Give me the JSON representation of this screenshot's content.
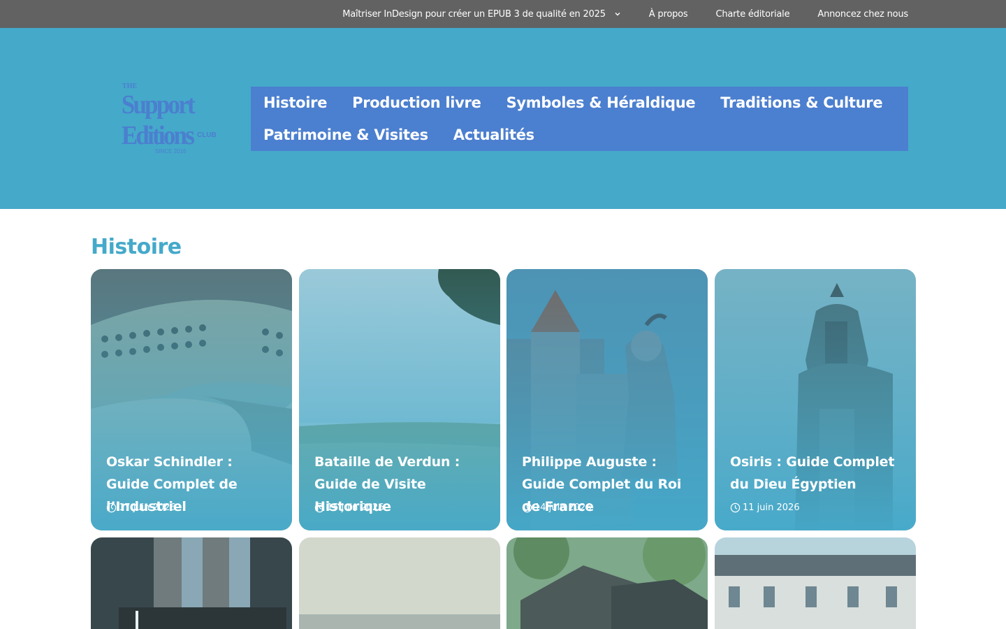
{
  "topbar": {
    "links": [
      {
        "label": "Maîtriser InDesign pour créer un EPUB 3 de qualité en 2025",
        "has_dropdown": true
      },
      {
        "label": "À propos"
      },
      {
        "label": "Charte éditoriale"
      },
      {
        "label": "Annoncez chez nous"
      }
    ]
  },
  "logo": {
    "the": "THE",
    "line1": "Support",
    "line2": "Editions",
    "club": "CLUB",
    "since": "SINCE 2016"
  },
  "nav": {
    "row1": [
      "Histoire",
      "Production livre",
      "Symboles & Héraldique",
      "Traditions & Culture"
    ],
    "row2": [
      "Patrimoine & Visites",
      "Actualités"
    ]
  },
  "section": {
    "title": "Histoire"
  },
  "cards": [
    {
      "title": "Oskar Schindler : Guide Complet de l’Industriel",
      "date": "17 juin 2026",
      "image": "control-room"
    },
    {
      "title": "Bataille de Verdun : Guide de Visite Historique",
      "date": "15 juin 2026",
      "image": "landscape"
    },
    {
      "title": "Philippe Auguste : Guide Complet du Roi de France",
      "date": "14 juin 2026",
      "image": "knight-castle"
    },
    {
      "title": "Osiris : Guide Complet du Dieu Égyptien",
      "date": "11 juin 2026",
      "image": "pharaoh-statue"
    }
  ],
  "cards_row2": [
    {
      "image": "church-window"
    },
    {
      "image": "misty-sea"
    },
    {
      "image": "wooden-house"
    },
    {
      "image": "chateau"
    }
  ],
  "colors": {
    "topbar": "#626262",
    "header": "#45a9ca",
    "nav": "#4b7fcf",
    "accent": "#45a9ca"
  }
}
